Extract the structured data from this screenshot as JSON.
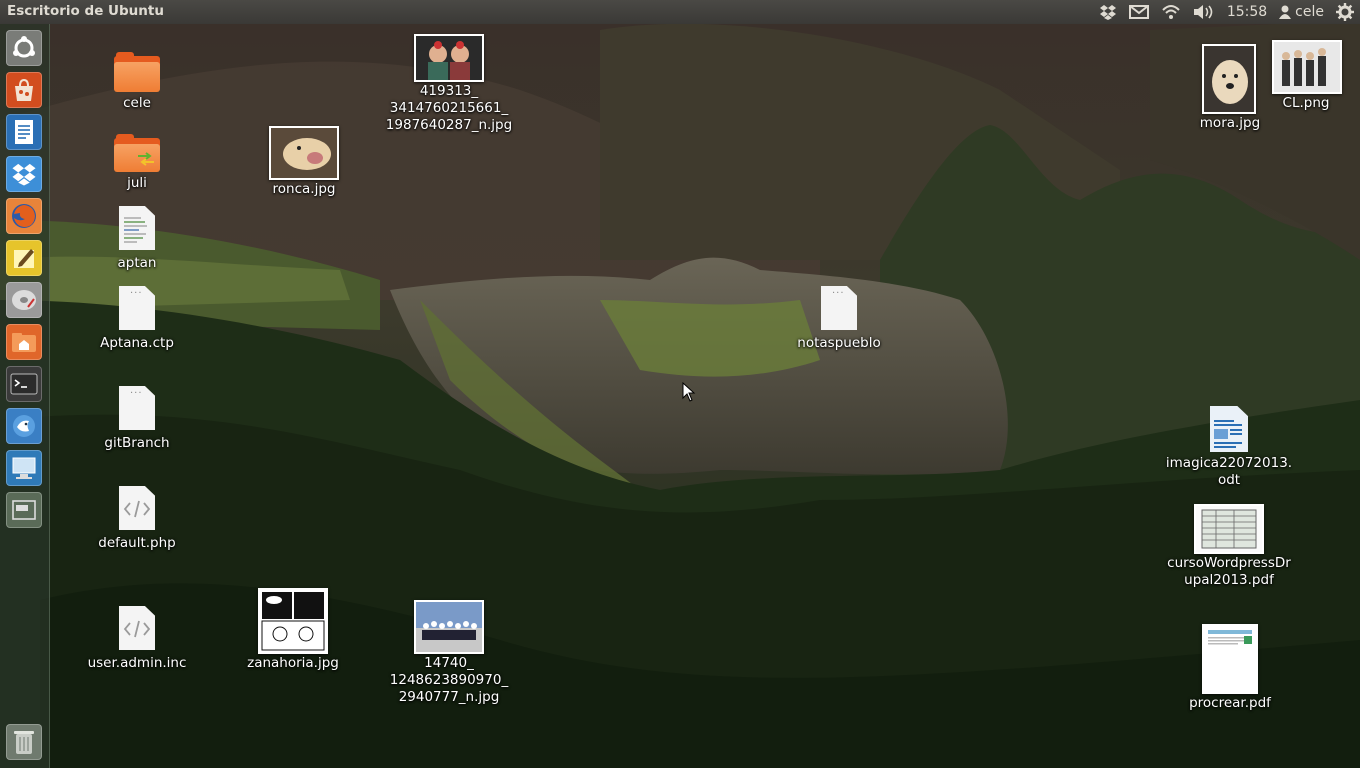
{
  "top_panel": {
    "title": "Escritorio de Ubuntu",
    "clock": "15:58",
    "user": "cele",
    "indicators": [
      "dropbox-icon",
      "mail-icon",
      "network-wifi-icon",
      "volume-icon",
      "user-icon",
      "session-gear-icon"
    ]
  },
  "launcher": {
    "items": [
      {
        "name": "dash-home",
        "icon": "ubuntu-logo-icon",
        "color": "#6d6f6b"
      },
      {
        "name": "software-center",
        "icon": "software-center-icon",
        "color": "#c2421a"
      },
      {
        "name": "libreoffice-writer",
        "icon": "writer-icon",
        "color": "#2a6fb5"
      },
      {
        "name": "dropbox",
        "icon": "dropbox-icon",
        "color": "#3d8fd8"
      },
      {
        "name": "firefox",
        "icon": "firefox-icon",
        "color": "#d9572a"
      },
      {
        "name": "text-editor",
        "icon": "notepad-icon",
        "color": "#e6c42b"
      },
      {
        "name": "disk-utility",
        "icon": "disk-icon",
        "color": "#b8b8b8"
      },
      {
        "name": "home-folder",
        "icon": "home-folder-icon",
        "color": "#e0662a"
      },
      {
        "name": "terminal",
        "icon": "terminal-icon",
        "color": "#2d2d2d"
      },
      {
        "name": "pidgin",
        "icon": "chat-bird-icon",
        "color": "#3a7fc4"
      },
      {
        "name": "remote-desktop",
        "icon": "remote-desktop-icon",
        "color": "#2f7ab8"
      },
      {
        "name": "workspace-switcher",
        "icon": "workspace-icon",
        "color": "#5a6b58"
      },
      {
        "name": "trash",
        "icon": "trash-icon",
        "color": "#6f7a6e"
      }
    ]
  },
  "desktop": {
    "icons": [
      {
        "label": "cele",
        "type": "folder"
      },
      {
        "label": "juli",
        "type": "shared-folder"
      },
      {
        "label": "aptan",
        "type": "text"
      },
      {
        "label": "Aptana.ctp",
        "type": "blank"
      },
      {
        "label": "gitBranch",
        "type": "blank"
      },
      {
        "label": "default.php",
        "type": "code"
      },
      {
        "label": "user.admin.inc",
        "type": "code"
      },
      {
        "label": "ronca.jpg",
        "type": "image"
      },
      {
        "label": "419313_\n3414760215661_\n1987640287_n.jpg",
        "type": "image"
      },
      {
        "label": "zanahoria.jpg",
        "type": "image"
      },
      {
        "label": "14740_\n1248623890970_\n2940777_n.jpg",
        "type": "image"
      },
      {
        "label": "notaspueblo",
        "type": "blank"
      },
      {
        "label": "mora.jpg",
        "type": "image"
      },
      {
        "label": "CL.png",
        "type": "image"
      },
      {
        "label": "imagica22072013.\nodt",
        "type": "odt"
      },
      {
        "label": "cursoWordpressDr\nupal2013.pdf",
        "type": "pdf"
      },
      {
        "label": "procrear.pdf",
        "type": "pdf"
      }
    ]
  }
}
